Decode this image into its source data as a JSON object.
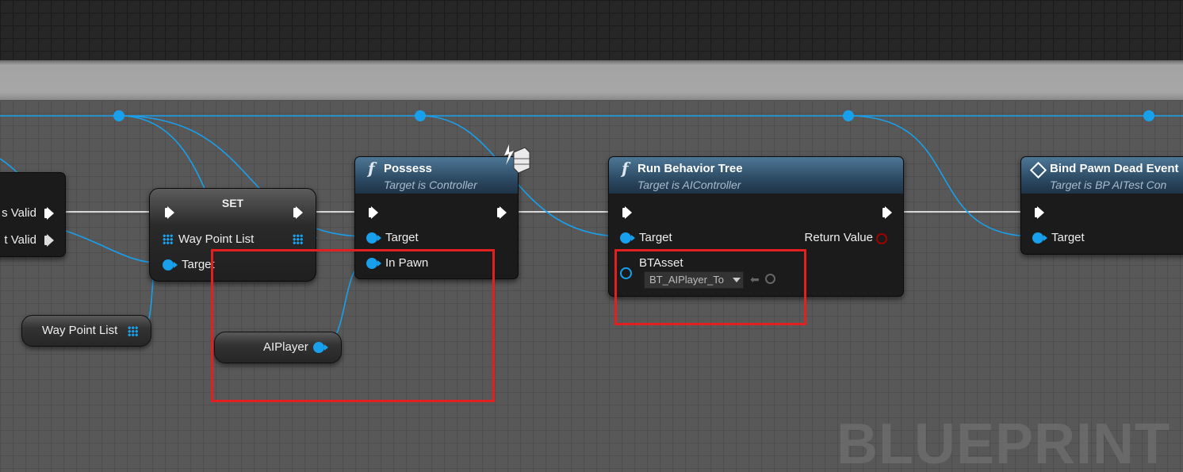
{
  "editor": {
    "watermark": "BLUEPRINT"
  },
  "colors": {
    "object_pin": "#19a0ec",
    "highlight": "#e32020",
    "exec_wire": "#d8d8d8",
    "return_pin": "#a00000"
  },
  "nodes": {
    "isvalid": {
      "pin_is_valid": "s Valid",
      "pin_not_valid": "t Valid"
    },
    "set": {
      "title": "SET",
      "pin_var": "Way Point List",
      "pin_target": "Target"
    },
    "waypoint_getter": {
      "label": "Way Point List"
    },
    "aiplayer_getter": {
      "label": "AIPlayer"
    },
    "possess": {
      "icon": "function-icon",
      "glyph": "f",
      "title": "Possess",
      "subtitle": "Target is Controller",
      "pin_target": "Target",
      "pin_in_pawn": "In Pawn"
    },
    "run_bt": {
      "icon": "function-icon",
      "glyph": "f",
      "title": "Run Behavior Tree",
      "subtitle": "Target is AIController",
      "pin_target": "Target",
      "pin_return": "Return Value",
      "pin_bt": "BTAsset",
      "bt_value": "BT_AIPlayer_To"
    },
    "bind_event": {
      "icon": "event-diamond-icon",
      "title": "Bind Pawn Dead Event",
      "subtitle": "Target is BP AITest Con",
      "pin_target": "Target"
    }
  }
}
